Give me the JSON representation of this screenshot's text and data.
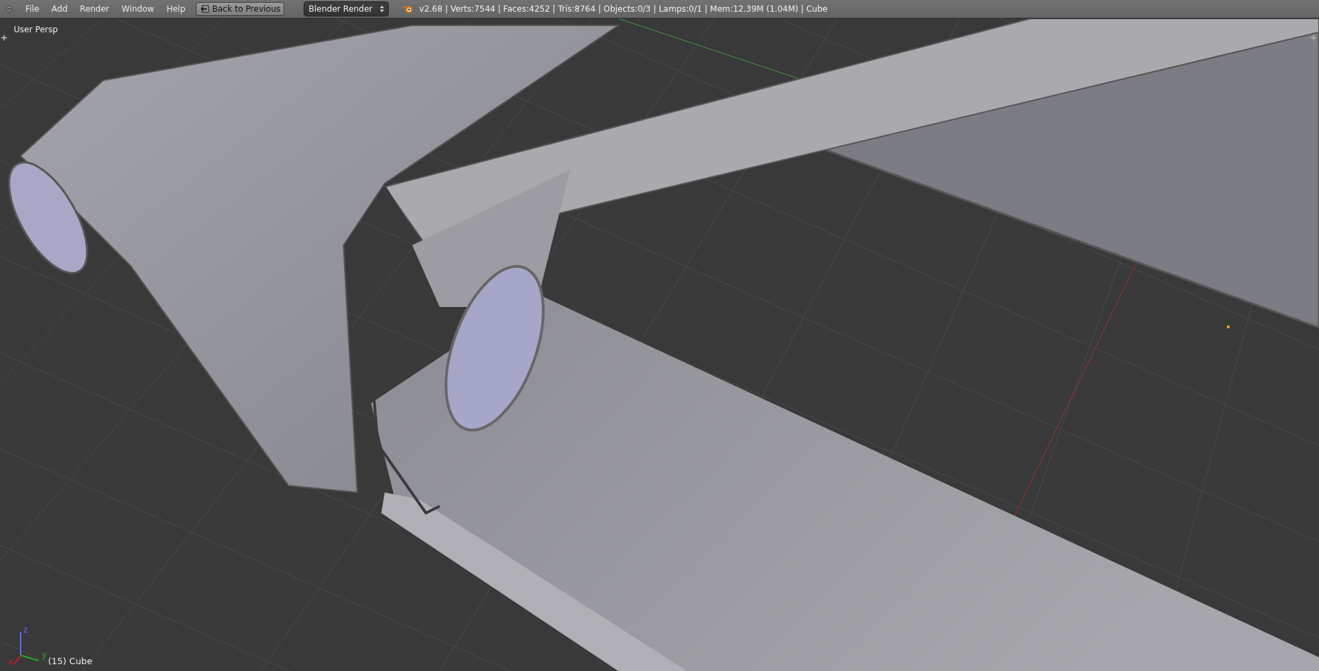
{
  "menu": [
    {
      "label": "File"
    },
    {
      "label": "Add"
    },
    {
      "label": "Render"
    },
    {
      "label": "Window"
    },
    {
      "label": "Help"
    }
  ],
  "back_button": {
    "label": "Back to Previous"
  },
  "render_engine": {
    "value": "Blender Render"
  },
  "stats": "v2.68 | Verts:7544 | Faces:4252 | Tris:8764 | Objects:0/3 | Lamps:0/1 | Mem:12.39M (1.04M) | Cube",
  "viewport": {
    "view_label": "User Persp",
    "object_label": "(15) Cube",
    "axes": [
      {
        "label": "z",
        "color": "#5a6aff"
      },
      {
        "label": "y",
        "color": "#20b020"
      },
      {
        "label": "x",
        "color": "#c82020"
      }
    ]
  }
}
